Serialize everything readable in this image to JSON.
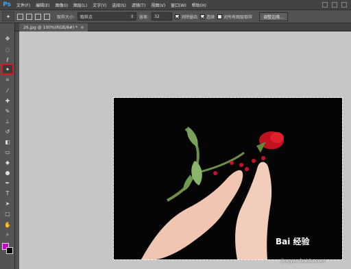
{
  "app": {
    "logo": "Ps"
  },
  "menu": [
    "文件(F)",
    "编辑(E)",
    "图像(I)",
    "图层(L)",
    "文字(Y)",
    "选择(S)",
    "滤镜(T)",
    "视图(V)",
    "窗口(W)",
    "帮助(H)"
  ],
  "options": {
    "sample_size_label": "取样大小:",
    "sample_size_value": "取样点",
    "tolerance_label": "容差:",
    "tolerance_value": "32",
    "antialias_label": "消除锯齿",
    "contiguous_label": "连续",
    "sample_all_layers_label": "对所有图层取样",
    "refine_edge_button": "调整边缘..."
  },
  "document": {
    "tab_title": "26.jpg @ 100%(RGB/8#) *",
    "close": "×"
  },
  "colors": {
    "foreground": "#c800c8",
    "background": "#000000",
    "active_tool_highlight": "#d6191f"
  },
  "tools": [
    "move-icon",
    "marquee-icon",
    "lasso-icon",
    "magic-wand-icon",
    "crop-icon",
    "eyedropper-icon",
    "healing-icon",
    "brush-icon",
    "stamp-icon",
    "history-brush-icon",
    "eraser-icon",
    "gradient-icon",
    "blur-icon",
    "dodge-icon",
    "pen-icon",
    "type-icon",
    "path-select-icon",
    "shape-icon",
    "hand-icon",
    "zoom-icon"
  ],
  "watermark": {
    "text": "Bai 经验",
    "sub": "jingyan.baidu.com"
  }
}
